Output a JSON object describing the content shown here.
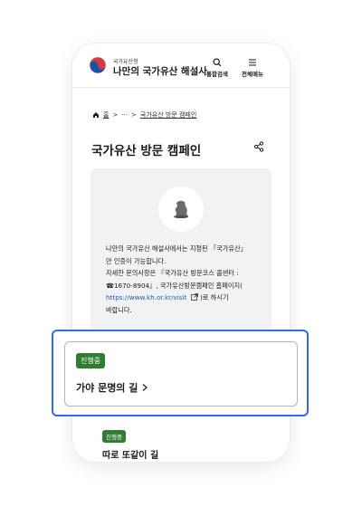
{
  "header": {
    "org_name": "국가유산청",
    "site_name": "나만의 국가유산 해설사",
    "search_label": "통합검색",
    "menu_label": "전체메뉴"
  },
  "breadcrumb": {
    "home_label": "홈",
    "sep1": ">",
    "ellipsis": "···",
    "sep2": ">",
    "current": "국가유산 방문 캠페인"
  },
  "page": {
    "title": "국가유산 방문 캠페인"
  },
  "info": {
    "line1": "나만의 국가유산 해설사에서는 지정된 「국가유산」",
    "line2": "만 인증이 가능합니다.",
    "line3": "자세한 문의사항은 『국가유산 방문코스 콜센터 :",
    "line4": "☎1670-8904』, 국가유산방문캠페인 홈페이지(",
    "link_text": "https://www.kh.or.kr/visit",
    "line5_after": ")로 하시기",
    "line6": "바랍니다."
  },
  "campaigns": [
    {
      "status": "진행중",
      "title": "가야 문명의 길"
    },
    {
      "status": "진행중",
      "title": "따로 또같이 길"
    }
  ],
  "colors": {
    "status_green": "#2e7d32",
    "highlight_blue": "#2f6ce5",
    "link_blue": "#2454c4"
  }
}
